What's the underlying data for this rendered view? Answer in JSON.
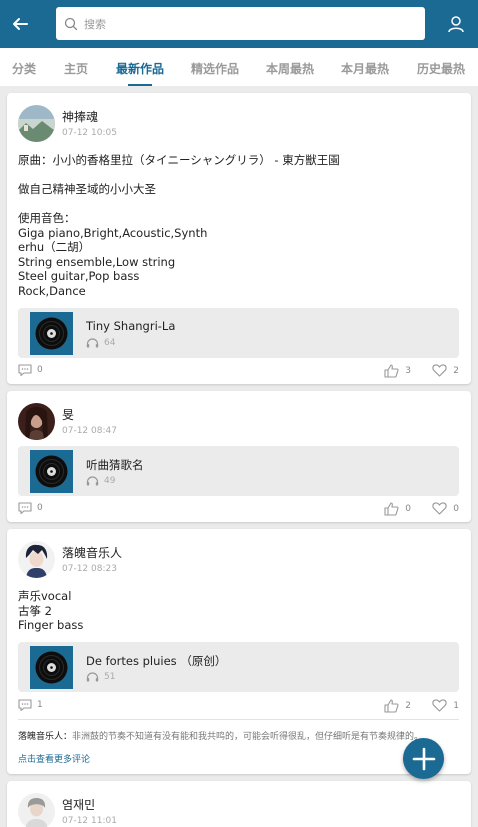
{
  "header": {
    "search_placeholder": "搜索",
    "colors": {
      "primary": "#1b6a94",
      "background": "#ebebeb"
    }
  },
  "tabs": [
    {
      "label": "分类"
    },
    {
      "label": "主页"
    },
    {
      "label": "最新作品",
      "active": true
    },
    {
      "label": "精选作品"
    },
    {
      "label": "本周最热"
    },
    {
      "label": "本月最热"
    },
    {
      "label": "历史最热"
    }
  ],
  "posts": [
    {
      "user": "神捧魂",
      "time": "07-12 10:05",
      "text": "原曲：小小的香格里拉（タイニーシャングリラ） - 東方獣王園\n\n做自己精神圣域的小小大圣\n\n使用音色：\nGiga piano,Bright,Acoustic,Synth\nerhu（二胡）\nString ensemble,Low string\nSteel guitar,Pop bass\nRock,Dance",
      "track": {
        "title": "Tiny Shangri-La",
        "plays": "64"
      },
      "comments": "0",
      "likes": "3",
      "favorites": "2"
    },
    {
      "user": "旻",
      "time": "07-12 08:47",
      "text": "",
      "track": {
        "title": "听曲猜歌名",
        "plays": "49"
      },
      "comments": "0",
      "likes": "0",
      "favorites": "0"
    },
    {
      "user": "落魄音乐人",
      "time": "07-12 08:23",
      "text": "声乐vocal\n古筝 2\nFinger bass",
      "track": {
        "title": "De fortes pluies （原创）",
        "plays": "51"
      },
      "comments": "1",
      "likes": "2",
      "favorites": "1",
      "comment_preview": {
        "author": "落魄音乐人：",
        "text": "非洲鼓的节奏不知道有没有能和我共鸣的，可能会听得很乱，但仔细听是有节奏规律的。"
      },
      "more_comments": "点击查看更多评论"
    },
    {
      "user": "염재민",
      "time": "07-12 11:01"
    }
  ]
}
